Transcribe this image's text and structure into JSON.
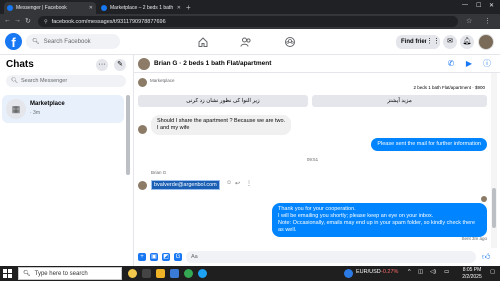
{
  "browser": {
    "tabs": [
      {
        "title": "Messenger | Facebook",
        "active": true
      },
      {
        "title": "Marketplace – 2 beds 1 bath Fl...",
        "active": false
      }
    ],
    "url": "facebook.com/messages/t/9311790978877696"
  },
  "fb_header": {
    "logo": "f",
    "search_placeholder": "Search Facebook",
    "find_friends_label": "Find friends"
  },
  "sidebar": {
    "title": "Chats",
    "search_placeholder": "Search Messenger",
    "conversations": [
      {
        "name": "Marketplace",
        "time": "· 3m"
      }
    ]
  },
  "chat": {
    "header_title": "Brian G · 2 beds 1 bath Flat/apartment",
    "marketplace_label": "Marketplace",
    "listing_info": "2 beds 1 bath Flat/apartment · $900",
    "quick_buttons": [
      "زیر النوا کی نظور نشان زد کرنی",
      "مزید آپشنز"
    ],
    "messages": {
      "incoming_1": "Should I share the apartment ? Because we are two.",
      "incoming_2": "I and my wife",
      "outgoing_1": "Please sent the mail for further information",
      "time_divider": "09:51",
      "sender_name": "Brian G",
      "email": "bvalverde@argenbol.com",
      "outgoing_2_line1": "Thank you for your cooperation.",
      "outgoing_2_line2": "I will be emailing you shortly; please keep an eye on your inbox.",
      "outgoing_2_line3": "Note: Occasionally, emails may end up in your spam folder, so kindly check there as well.",
      "seen": "Sent 3m ago"
    },
    "composer_placeholder": "Aa"
  },
  "taskbar": {
    "search_placeholder": "Type here to search",
    "currency_label": "EUR/USD",
    "currency_change": "-0.27%",
    "time": "8:05 PM",
    "date": "2/2/2025"
  },
  "colors": {
    "fb_blue": "#1877f2",
    "bubble_out": "#0084ff",
    "negative": "#ff6b6b"
  }
}
